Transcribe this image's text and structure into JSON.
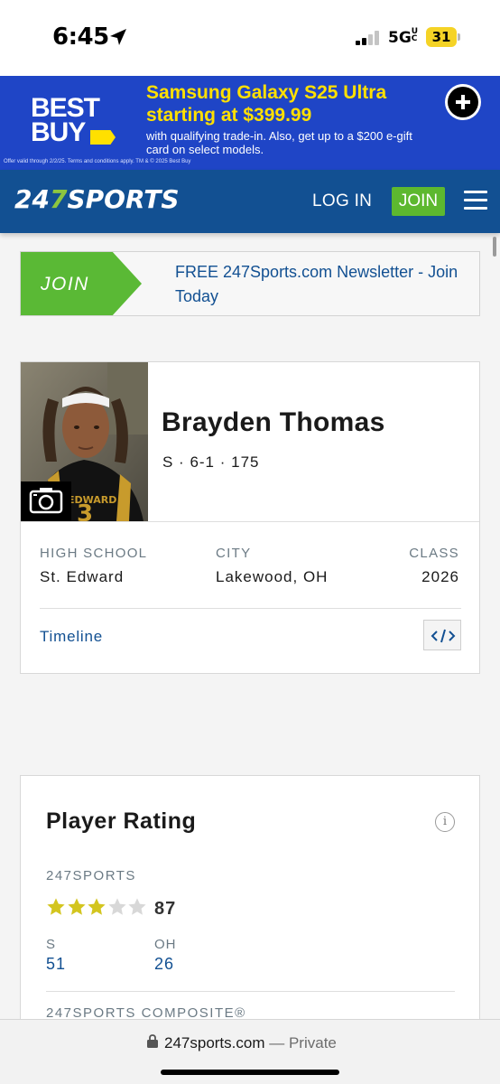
{
  "status_bar": {
    "time": "6:45",
    "network": "5G",
    "network_badge": "UC",
    "battery": "31"
  },
  "ad": {
    "brand_line1": "BEST",
    "brand_line2": "BUY",
    "headline": "Samsung Galaxy S25 Ultra starting at $399.99",
    "subtext": "with qualifying trade-in. Also, get up to a $200 e-gift card on select models.",
    "fine_print": "Offer valid through 2/2/25. Terms and conditions apply. TM & © 2025 Best Buy"
  },
  "nav": {
    "logo_prefix": "24",
    "logo_seven": "7",
    "logo_suffix": "SPORTS",
    "login_label": "LOG IN",
    "join_label": "JOIN"
  },
  "newsletter": {
    "join_label": "JOIN",
    "text": "FREE 247Sports.com Newsletter - Join Today"
  },
  "player": {
    "name": "Brayden Thomas",
    "meta": "S · 6-1 · 175",
    "high_school_label": "HIGH SCHOOL",
    "high_school": "St. Edward",
    "city_label": "CITY",
    "city": "Lakewood, OH",
    "class_label": "CLASS",
    "class_year": "2026",
    "timeline_label": "Timeline",
    "embed_label": "</>"
  },
  "rating": {
    "title": "Player Rating",
    "info": "i",
    "source_label": "247SPORTS",
    "stars_filled": 3,
    "stars_total": 5,
    "score": "87",
    "position_label": "S",
    "position_rank": "51",
    "state_label": "OH",
    "state_rank": "26",
    "composite_label": "247SPORTS COMPOSITE®"
  },
  "browser": {
    "url": "247sports.com",
    "mode": "— Private"
  },
  "colors": {
    "nav_blue": "#125092",
    "join_green": "#5db82f",
    "ad_blue": "#1f45c6",
    "ad_yellow": "#ffe000",
    "star_gold": "#d3c51f",
    "star_gray": "#d8d8d8"
  }
}
